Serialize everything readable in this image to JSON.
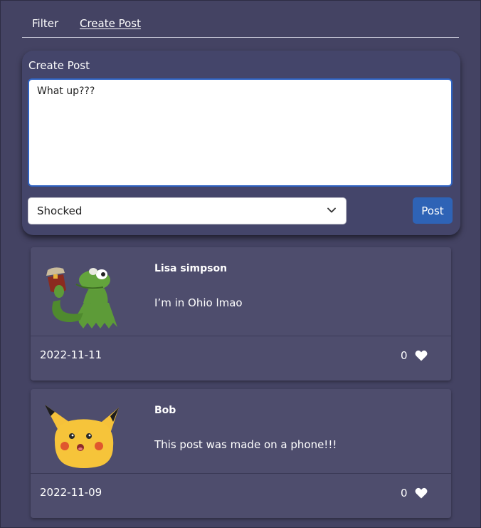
{
  "tabs": [
    {
      "label": "Filter"
    },
    {
      "label": "Create Post"
    }
  ],
  "create_post": {
    "title": "Create Post",
    "text_value": "What up???",
    "mood_selected": "Shocked",
    "post_button": "Post"
  },
  "posts": [
    {
      "author": "Lisa simpson",
      "text": "I’m in Ohio lmao",
      "date": "2022-11-11",
      "likes": "0",
      "avatar_icon": "kermit-tea-icon"
    },
    {
      "author": "Bob",
      "text": "This post was made on a phone!!!",
      "date": "2022-11-09",
      "likes": "0",
      "avatar_icon": "surprised-pikachu-icon"
    }
  ],
  "colors": {
    "background": "#444363",
    "card": "#4e4d6d",
    "accent": "#2e63b6"
  }
}
